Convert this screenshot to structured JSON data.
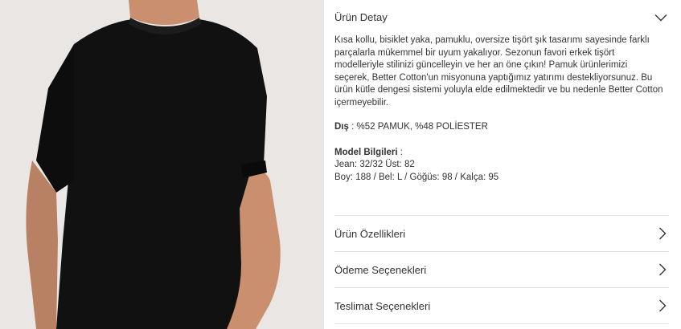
{
  "product_image": {
    "alt": "",
    "colors": {
      "background": "#e9e6e3",
      "shirt": "#111111",
      "skin": "#c98f6e"
    }
  },
  "detail_section": {
    "title": "Ürün Detay",
    "icon": "chevron-down-icon",
    "description": "Kısa kollu, bisiklet yaka, pamuklu, oversize tişört şık tasarımı sayesinde farklı parçalarla mükemmel bir uyum yakalıyor. Sezonun favori erkek tişört modelleriyle stilinizi güncelleyin ve her an öne çıkın! Pamuk ürünlerimizi seçerek, Better Cotton'un misyonuna yaptığımız yatırımı destekliyorsunuz. Bu ürün kütle dengesi sistemi yoluyla elde edilmektedir ve bu nedenle Better Cotton içermeyebilir.",
    "material": {
      "label": "Dış",
      "separator": " : ",
      "value": "%52 PAMUK, %48 POLİESTER"
    },
    "model": {
      "label": "Model Bilgileri",
      "separator": " :",
      "line1": "Jean: 32/32 Üst: 82",
      "line2": "Boy: 188 / Bel: L / Göğüs: 98 / Kalça: 95"
    }
  },
  "accordion_rows": [
    {
      "label": "Ürün Özellikleri",
      "icon": "chevron-right-icon"
    },
    {
      "label": "Ödeme Seçenekleri",
      "icon": "chevron-right-icon"
    },
    {
      "label": "Teslimat Seçenekleri",
      "icon": "chevron-right-icon"
    }
  ],
  "colors": {
    "text": "#333333",
    "divider": "#e2e2e2",
    "chevron": "#333333"
  }
}
